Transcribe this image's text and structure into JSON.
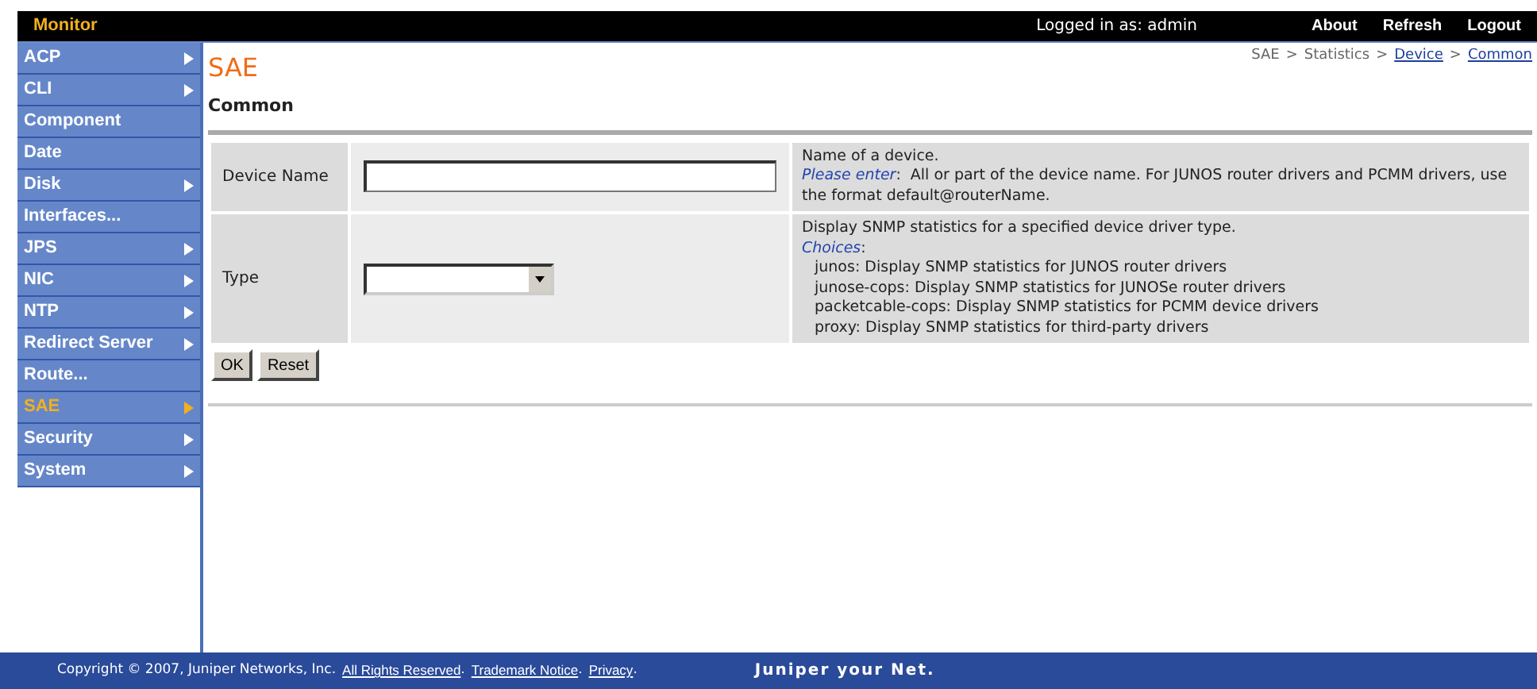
{
  "header": {
    "title": "Monitor",
    "login": "Logged in as: admin",
    "links": [
      "About",
      "Refresh",
      "Logout"
    ]
  },
  "sidebar": {
    "items": [
      {
        "label": "ACP",
        "submenu": true,
        "selected": false
      },
      {
        "label": "CLI",
        "submenu": true,
        "selected": false
      },
      {
        "label": "Component",
        "submenu": false,
        "selected": false
      },
      {
        "label": "Date",
        "submenu": false,
        "selected": false
      },
      {
        "label": "Disk",
        "submenu": true,
        "selected": false
      },
      {
        "label": "Interfaces...",
        "submenu": false,
        "selected": false
      },
      {
        "label": "JPS",
        "submenu": true,
        "selected": false
      },
      {
        "label": "NIC",
        "submenu": true,
        "selected": false
      },
      {
        "label": "NTP",
        "submenu": true,
        "selected": false
      },
      {
        "label": "Redirect Server",
        "submenu": true,
        "selected": false
      },
      {
        "label": "Route...",
        "submenu": false,
        "selected": false
      },
      {
        "label": "SAE",
        "submenu": true,
        "selected": true
      },
      {
        "label": "Security",
        "submenu": true,
        "selected": false
      },
      {
        "label": "System",
        "submenu": true,
        "selected": false
      }
    ]
  },
  "breadcrumb": [
    {
      "label": "SAE",
      "link": false
    },
    {
      "label": "Statistics",
      "link": false
    },
    {
      "label": "Device",
      "link": true
    },
    {
      "label": "Common",
      "link": true
    }
  ],
  "breadcrumb_separator": ">",
  "page": {
    "title": "SAE",
    "subtitle": "Common"
  },
  "form": {
    "rows": [
      {
        "label": "Device Name",
        "kind": "text",
        "help": "Name of a device.",
        "hint_label": "Please enter",
        "hint_separator": ":",
        "hint": "All or part of the device name. For JUNOS router drivers and PCMM drivers, use the format default@routerName."
      },
      {
        "label": "Type",
        "kind": "select",
        "help": "Display SNMP statistics for a specified device driver type.",
        "hint_label": "Choices",
        "hint_separator": ":",
        "choices": [
          "junos: Display SNMP statistics for JUNOS router drivers",
          "junose-cops: Display SNMP statistics for JUNOSe router drivers",
          "packetcable-cops: Display SNMP statistics for PCMM device drivers",
          "proxy: Display SNMP statistics for third-party drivers"
        ]
      }
    ],
    "buttons": [
      "OK",
      "Reset"
    ]
  },
  "footer": {
    "copyright": "Copyright © 2007, Juniper Networks, Inc.",
    "links": [
      "All Rights Reserved",
      "Trademark Notice",
      "Privacy"
    ],
    "link_separator": ".",
    "logo": "Juniper your Net."
  }
}
